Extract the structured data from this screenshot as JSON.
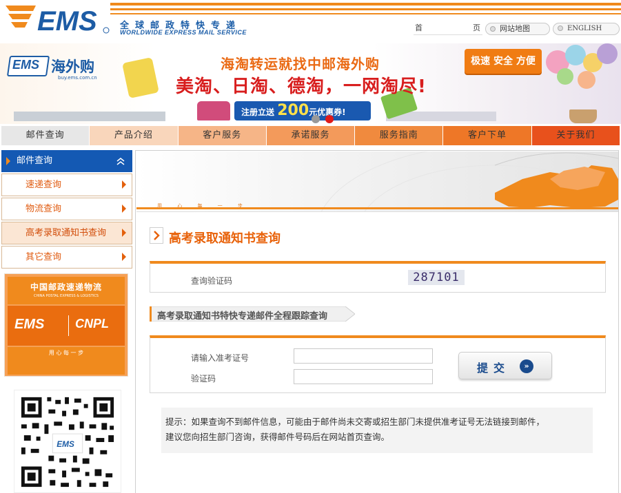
{
  "header": {
    "logo_text": "EMS",
    "slogan_cn": "全球邮政特快专递",
    "slogan_en": "WORLDWIDE EXPRESS MAIL SERVICE",
    "links": {
      "home_a": "首",
      "home_b": "页",
      "sitemap": "网站地图",
      "english": "ENGLISH"
    }
  },
  "banner": {
    "logo_ems": "EMS",
    "logo_brand": "海外购",
    "logo_url": "buy.ems.com.cn",
    "headline": "海淘转运就找中邮海外购",
    "subheadline": "美淘、日淘、德淘，一网淘尽!",
    "tag": "极速 安全 方便",
    "register_prefix": "注册立送",
    "register_amount": "200",
    "register_suffix": "元优惠券!"
  },
  "nav": {
    "items": [
      {
        "label": "邮件查询",
        "bg": "#e7e7e7"
      },
      {
        "label": "产品介绍",
        "bg": "#f9d6bb"
      },
      {
        "label": "客户服务",
        "bg": "#f6b587"
      },
      {
        "label": "承诺服务",
        "bg": "#f39a5b"
      },
      {
        "label": "服务指南",
        "bg": "#f08a3e"
      },
      {
        "label": "客户下单",
        "bg": "#ee7727"
      },
      {
        "label": "关于我们",
        "bg": "#e8511c"
      }
    ]
  },
  "sidebar": {
    "header": "邮件查询",
    "items": [
      {
        "label": "速递查询"
      },
      {
        "label": "物流查询"
      },
      {
        "label": "高考录取通知书查询"
      },
      {
        "label": "其它查询"
      }
    ],
    "logo_cn": "中国邮政速递物流",
    "logo_en": "CHINA POSTAL EXPRESS & LOGISTICS",
    "logo_ems": "EMS",
    "logo_cnpl": "CNPL",
    "logo_motto": "用 心 每 一 步"
  },
  "main": {
    "banner_motto": "用 心 每 一 步",
    "title": "高考录取通知书查询",
    "captcha_label": "查询验证码",
    "captcha_value": "287101",
    "section_title": "高考录取通知书特快专递邮件全程跟踪查询",
    "exam_label": "请输入准考证号",
    "code_label": "验证码",
    "exam_value": "",
    "code_value": "",
    "submit_label": "提交",
    "note_line1": "提示：如果查询不到邮件信息，可能由于邮件尚未交寄或招生部门未提供准考证号无法链接到邮件，",
    "note_line2": "建议您向招生部门咨询，获得邮件号码后在网站首页查询。"
  },
  "colors": {
    "accent": "#f08a1d",
    "blue": "#1459b3",
    "title": "#e8620a"
  }
}
